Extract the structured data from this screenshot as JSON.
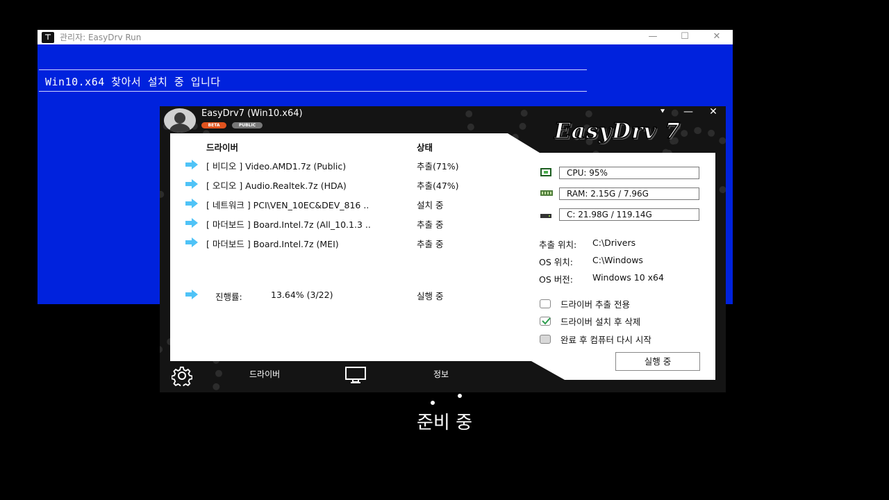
{
  "console": {
    "title": "관리자:  EasyDrv Run",
    "app_icon": "terminal-icon",
    "controls": {
      "minimize": "—",
      "maximize": "☐",
      "close": "✕"
    },
    "message": "Win10.x64 찾아서 설치 중 입니다"
  },
  "easydrv": {
    "title": "EasyDrv7 (Win10.x64)",
    "badges": {
      "beta": "BETA",
      "public": "PUBLIC"
    },
    "logo": "EasyDrv 7",
    "controls": {
      "menu": "⯆",
      "minimize": "—",
      "close": "✕"
    },
    "columns": {
      "driver": "드라이버",
      "status": "상태"
    },
    "drivers": [
      {
        "name": "[ 비디오 ] Video.AMD1.7z (Public)",
        "status": "추출(71%)"
      },
      {
        "name": "[ 오디오 ] Audio.Realtek.7z (HDA)",
        "status": "추출(47%)"
      },
      {
        "name": "[ 네트워크 ] PCI\\VEN_10EC&DEV_816 ..",
        "status": "설치 중"
      },
      {
        "name": "[ 마더보드 ] Board.Intel.7z (All_10.1.3 ..",
        "status": "추출 중"
      },
      {
        "name": "[ 마더보드 ] Board.Intel.7z (MEI)",
        "status": "추출 중"
      }
    ],
    "progress": {
      "label": "진행률:",
      "value": "13.64% (3/22)",
      "status": "실행 중"
    },
    "stats": {
      "cpu": "CPU:  95%",
      "ram": "RAM: 2.15G / 7.96G",
      "disk": "C:      21.98G / 119.14G"
    },
    "info": {
      "extract_label": "추출 위치:",
      "extract_value": "C:\\Drivers",
      "os_label": "OS 위치:",
      "os_value": "C:\\Windows",
      "ver_label": "OS 버전:",
      "ver_value": "Windows 10 x64"
    },
    "options": [
      {
        "label": "드라이버 추출 전용",
        "checked": false
      },
      {
        "label": "드라이버 설치 후 삭제",
        "checked": true
      },
      {
        "label": "완료 후 컴퓨터 다시 시작",
        "checked": false,
        "disabled": true
      }
    ],
    "run_button": "실행 중",
    "toolbar": {
      "driver": "드라이버",
      "info": "정보"
    },
    "accent": "#4fc3f7"
  },
  "loading_text": "준비 중"
}
